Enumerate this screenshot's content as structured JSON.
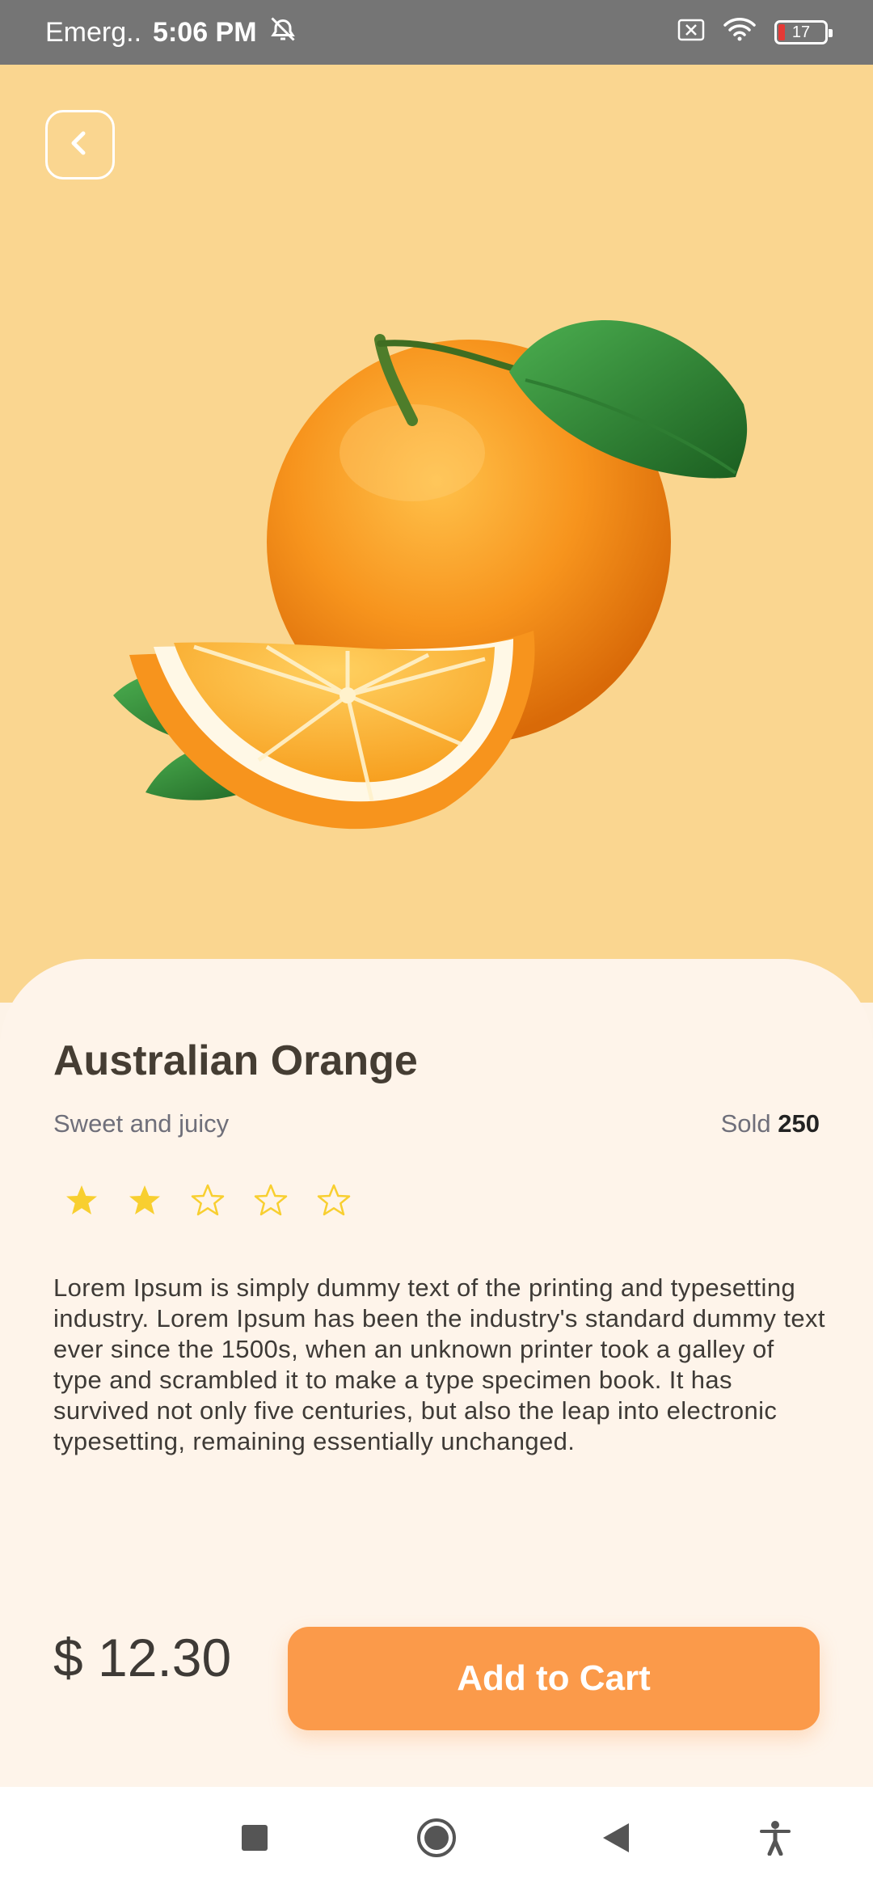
{
  "status_bar": {
    "carrier": "Emerg..",
    "time": "5:06 PM",
    "battery_level": "17"
  },
  "product": {
    "title": "Australian Orange",
    "subtitle": "Sweet and juicy",
    "sold_label": "Sold",
    "sold_count": "250",
    "rating": 2,
    "rating_max": 5,
    "description": "Lorem Ipsum is simply dummy text of the printing and typesetting industry. Lorem Ipsum has been the industry's standard dummy text ever since the 1500s, when an unknown printer took a galley of type and scrambled it to make a type specimen book. It has survived not only five centuries, but also the leap into electronic typesetting, remaining essentially unchanged.",
    "price": "$ 12.30",
    "add_to_cart_label": "Add to Cart"
  },
  "colors": {
    "hero_background": "#fad690",
    "sheet_background": "#fef4ea",
    "accent": "#fb9a4a",
    "star": "#f8cf30"
  },
  "icons": {
    "back": "chevron-left-icon",
    "recents": "square-icon",
    "home": "circle-icon",
    "back_nav": "triangle-left-icon",
    "accessibility": "accessibility-icon"
  }
}
